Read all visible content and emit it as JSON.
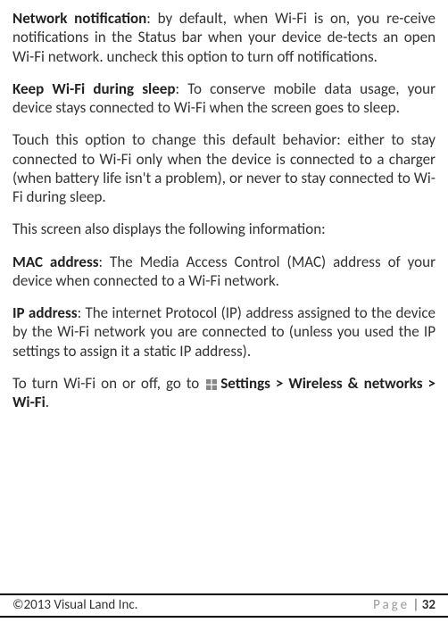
{
  "content": {
    "p1_bold": "Network notification",
    "p1_text": ": by default, when Wi-Fi is on, you re-ceive notifications in the Status bar when your device de-tects an open Wi-Fi network. uncheck this option to turn off notifications.",
    "p2_bold": "Keep Wi-Fi during sleep",
    "p2_text": ": To conserve mobile data usage, your device stays connected to Wi-Fi when the screen goes to sleep.",
    "p3_text": "Touch this option to change this default behavior: either to stay connected to Wi-Fi only when the device is connected to a charger (when battery life isn't a problem), or never to stay connected to Wi-Fi during sleep.",
    "p4_text": "This screen also displays the following information:",
    "p5_bold": "MAC address",
    "p5_text": ": The Media Access Control (MAC) address of your device when connected to a Wi-Fi network.",
    "p6_bold": "IP address",
    "p6_text": ": The internet Protocol (IP) address assigned to the device by the Wi-Fi network you are connected to (unless you used the IP settings to assign it a static IP address).",
    "p7_prefix": "To turn Wi-Fi on or off, go to ",
    "p7_bold": "Settings > Wireless & networks > Wi-Fi",
    "p7_suffix": "."
  },
  "footer": {
    "copyright": "©2013 Visual Land Inc.",
    "page_label": "Page",
    "separator": " | ",
    "page_number": "32"
  }
}
